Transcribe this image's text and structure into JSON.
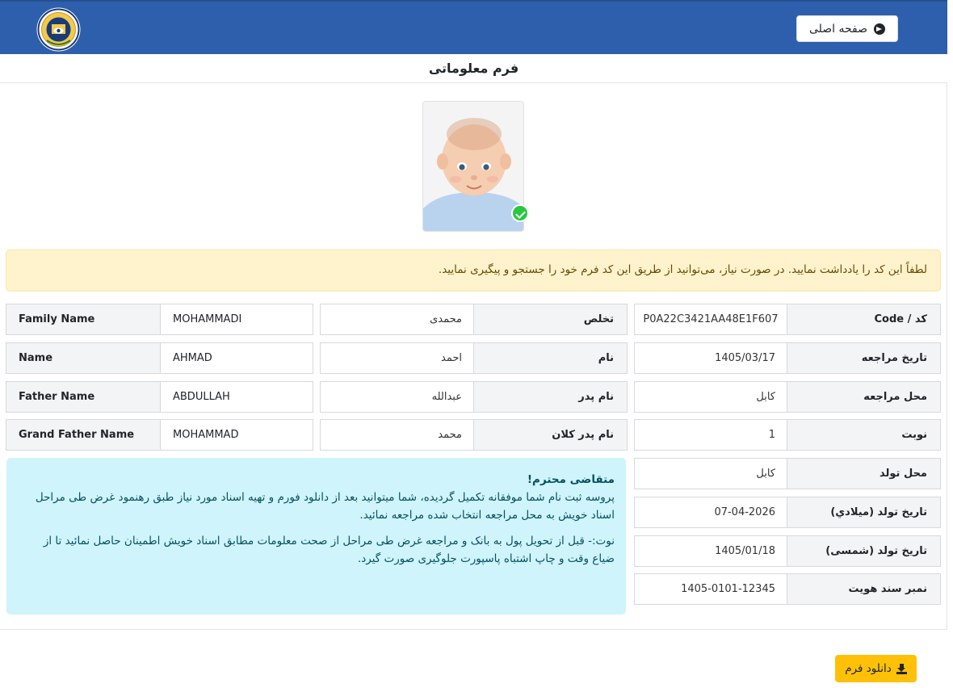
{
  "header": {
    "home_label": "صفحه اصلی",
    "colors": {
      "navbar": "#2d5fac",
      "warning_bg": "#fff3cd",
      "info_bg": "#cff4fc",
      "download_btn": "#ffc107"
    }
  },
  "page_title": "فرم معلوماتی",
  "warning_text": "لطفاً این کد را یادداشت نمایید. در صورت نیاز، می‌توانید از طریق این کد فرم خود را جستجو و پیگیری نمایید.",
  "english_fields": [
    {
      "label": "Family Name",
      "value": "MOHAMMADI"
    },
    {
      "label": "Name",
      "value": "AHMAD"
    },
    {
      "label": "Father Name",
      "value": "ABDULLAH"
    },
    {
      "label": "Grand Father Name",
      "value": "MOHAMMAD"
    }
  ],
  "dari_fields": [
    {
      "label": "تخلص",
      "value": "محمدی"
    },
    {
      "label": "نام",
      "value": "احمد"
    },
    {
      "label": "نام پدر",
      "value": "عبدالله"
    },
    {
      "label": "نام پدر کلان",
      "value": "محمد"
    }
  ],
  "info_fields": [
    {
      "label": "کد / Code",
      "value": "P0A22C3421AA48E1F607"
    },
    {
      "label": "تاریخ مراجعه",
      "value": "1405/03/17"
    },
    {
      "label": "محل مراجعه",
      "value": "کابل"
    },
    {
      "label": "نوبت",
      "value": "1"
    },
    {
      "label": "محل تولد",
      "value": "کابل"
    },
    {
      "label": "تاریخ تولد (میلادي)",
      "value": "07-04-2026"
    },
    {
      "label": "تاریخ تولد (شمسی)",
      "value": "1405/01/18"
    },
    {
      "label": "نمبر سند هویت",
      "value": "1405-0101-12345"
    }
  ],
  "info_box": {
    "heading": "متقاضی محترم!",
    "text1": "پروسه ثبت نام شما موفقانه تکمیل گردیده، شما میتوانید بعد از دانلود فورم و تهیه اسناد مورد نیاز طبق رهنمود غرض طی مراحل اسناد خویش به محل مراجعه انتخاب شده مراجعه نمائید.",
    "text2": "نوت:- قبل از تحویل پول به بانک و مراجعه غرض طی مراحل از صحت معلومات مطابق اسناد خویش اطمینان حاصل نمائید تا از ضیاع وقت و چاپ اشتباه پاسپورت جلوگیری صورت گیرد."
  },
  "download_label": "دانلود فرم"
}
